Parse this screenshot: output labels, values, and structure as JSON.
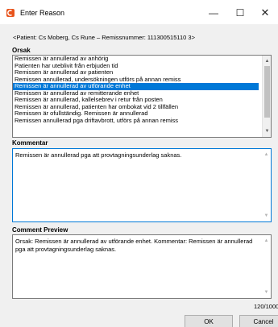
{
  "window": {
    "title": "Enter Reason",
    "minimize_glyph": "—",
    "maximize_glyph": "☐",
    "close_glyph": "✕"
  },
  "patient_line": "<Patient: Cs Moberg, Cs Rune – Remissnummer: 111300515110 3>",
  "orsak": {
    "label": "Orsak",
    "items": [
      "Remissen är annullerad av anhörig",
      "Patienten har uteblivit från erbjuden tid",
      "Remissen är annullerad av patienten",
      "Remissen annullerad, undersökningen utförs på annan remiss",
      "Remissen är annullerad av utförande enhet",
      "Remissen är annullerad av remitterande enhet",
      "Remissen är annullerad, kallelsebrev i retur från posten",
      "Remissen är annullerad, patienten har ombokat vid 2 tillfällen",
      "Remissen är ofullständig. Remissen är annullerad",
      "Remissen annullerad pga driftavbrott, utförs på annan remiss"
    ],
    "selected_index": 4
  },
  "kommentar": {
    "label": "Kommentar",
    "value": "Remissen är annullerad pga att provtagningsunderlag saknas."
  },
  "preview": {
    "label": "Comment Preview",
    "value": "Orsak: Remissen är annullerad av utförande enhet. Kommentar: Remissen är annullerad pga att provtagningsunderlag saknas."
  },
  "counter": "120/1000",
  "buttons": {
    "ok": "OK",
    "cancel": "Cancel"
  },
  "colors": {
    "selection": "#0078d7",
    "app_icon": "#e8541c"
  },
  "icons": {
    "app": "app-icon",
    "scroll_up": "chevron-up-icon",
    "scroll_down": "chevron-down-icon"
  }
}
